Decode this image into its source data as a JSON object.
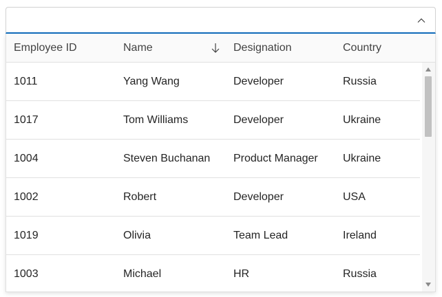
{
  "combo": {
    "value": "",
    "placeholder": "",
    "icon": "chevron-up-icon"
  },
  "grid": {
    "columns": [
      {
        "label": "Employee ID"
      },
      {
        "label": "Name",
        "sort": "descending",
        "sort_icon": "arrow-down-icon"
      },
      {
        "label": "Designation"
      },
      {
        "label": "Country"
      }
    ],
    "rows": [
      {
        "id": "1011",
        "name": "Yang Wang",
        "designation": "Developer",
        "country": "Russia"
      },
      {
        "id": "1017",
        "name": "Tom Williams",
        "designation": "Developer",
        "country": "Ukraine"
      },
      {
        "id": "1004",
        "name": "Steven Buchanan",
        "designation": "Product Manager",
        "country": "Ukraine"
      },
      {
        "id": "1002",
        "name": "Robert",
        "designation": "Developer",
        "country": "USA"
      },
      {
        "id": "1019",
        "name": "Olivia",
        "designation": "Team Lead",
        "country": "Ireland"
      },
      {
        "id": "1003",
        "name": "Michael",
        "designation": "HR",
        "country": "Russia"
      }
    ]
  },
  "colors": {
    "accent": "#0f6cbd",
    "border": "#e0e0e0",
    "header_bg": "#fafafa",
    "text": "#242424"
  }
}
